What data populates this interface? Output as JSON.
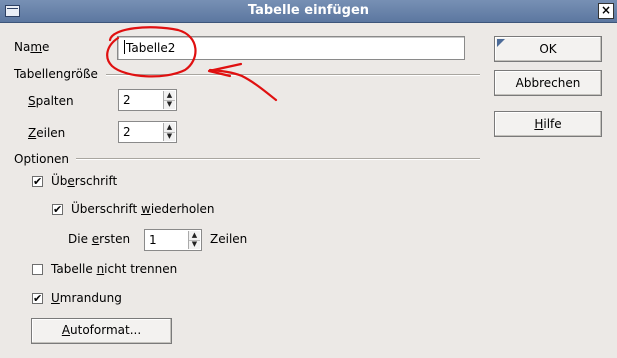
{
  "window": {
    "title": "Tabelle einfügen",
    "close_glyph": "×"
  },
  "name_row": {
    "label_pre": "Na",
    "label_accel": "m",
    "label_post": "e",
    "value": "Tabelle2"
  },
  "size_group": {
    "title": "Tabellengröße",
    "columns": {
      "label_accel": "S",
      "label_post": "palten",
      "value": "2"
    },
    "rows": {
      "label_accel": "Z",
      "label_post": "eilen",
      "value": "2"
    }
  },
  "options_group": {
    "title": "Optionen",
    "heading": {
      "label_pre": "Üb",
      "label_accel": "e",
      "label_post": "rschrift",
      "checked": true
    },
    "repeat_heading": {
      "label_pre": "Überschrift ",
      "label_accel": "w",
      "label_post": "iederholen",
      "checked": true
    },
    "first_rows": {
      "label_pre": "Die ",
      "label_accel": "e",
      "label_post": "rsten",
      "value": "1",
      "suffix": "Zeilen"
    },
    "dont_split": {
      "label_pre": "Tabelle ",
      "label_accel": "n",
      "label_post": "icht trennen",
      "checked": false
    },
    "border": {
      "label_accel": "U",
      "label_post": "mrandung",
      "checked": true
    },
    "autoformat": {
      "label_accel": "A",
      "label_post": "utoformat..."
    }
  },
  "buttons": {
    "ok": "OK",
    "cancel": "Abbrechen",
    "help_accel": "H",
    "help_post": "ilfe"
  },
  "annotation": {
    "color": "#E01010"
  },
  "icons": {
    "check": "✔",
    "up": "▲",
    "down": "▼"
  }
}
